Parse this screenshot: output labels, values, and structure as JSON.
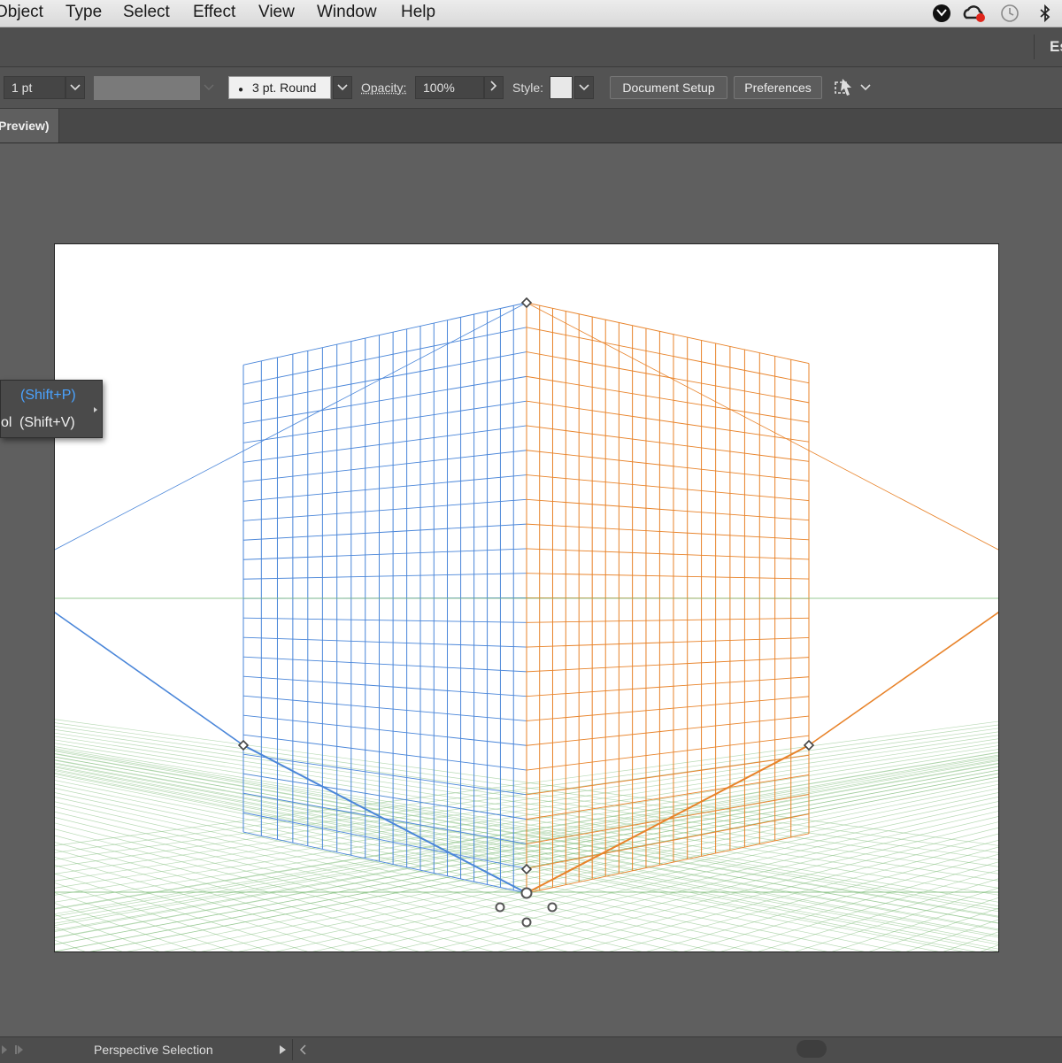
{
  "menubar": {
    "items": [
      "Object",
      "Type",
      "Select",
      "Effect",
      "View",
      "Window",
      "Help"
    ],
    "tray_icons": [
      "cursor-badge-icon",
      "creative-cloud-icon",
      "time-machine-icon",
      "bluetooth-icon"
    ]
  },
  "workspace": {
    "label": "Es"
  },
  "controlbar": {
    "stroke_weight": "1 pt",
    "brush": "3 pt. Round",
    "opacity_label": "Opacity:",
    "opacity_value": "100%",
    "style_label": "Style:",
    "document_setup": "Document Setup",
    "preferences": "Preferences"
  },
  "tab": {
    "label": "Preview)"
  },
  "flyout": {
    "items": [
      {
        "label": "",
        "shortcut": "(Shift+P)",
        "highlighted": true
      },
      {
        "label": "ol",
        "shortcut": "(Shift+V)",
        "highlighted": false
      }
    ]
  },
  "statusbar": {
    "tool": "Perspective Selection"
  },
  "colors": {
    "left_grid": "#4a86d9",
    "right_grid": "#e8832a",
    "ground_grid": "#7dbb78",
    "highlight_text": "#4aa3ff"
  }
}
